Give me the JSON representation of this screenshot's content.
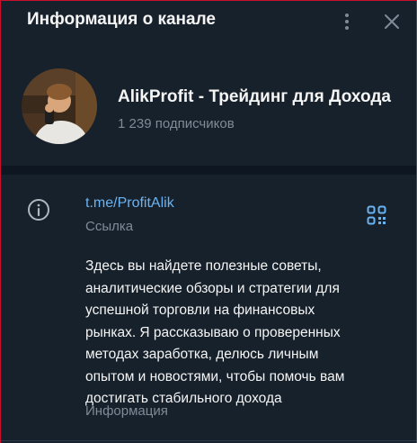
{
  "header": {
    "title": "Информация о канале",
    "menu_icon": "more-vertical-icon",
    "close_icon": "close-icon"
  },
  "profile": {
    "name": "AlikProfit - Трейдинг для Дохода",
    "subscribers": "1 239 подписчиков"
  },
  "info": {
    "link": "t.me/ProfitAlik",
    "link_label": "Ссылка",
    "description_lines": [
      "Здесь вы найдете полезные советы,",
      "аналитические обзоры и стратегии для",
      "успешной торговли на финансовых",
      "рынках. Я рассказываю о проверенных",
      "методах заработка, делюсь личным",
      "опытом и новостями, чтобы помочь вам",
      "достигать стабильного дохода"
    ],
    "description_label": "Информация"
  },
  "colors": {
    "background": "#17212b",
    "accent_link": "#6ab3f3",
    "secondary_text": "#7f8b97",
    "primary_text": "#f5f5f5"
  }
}
